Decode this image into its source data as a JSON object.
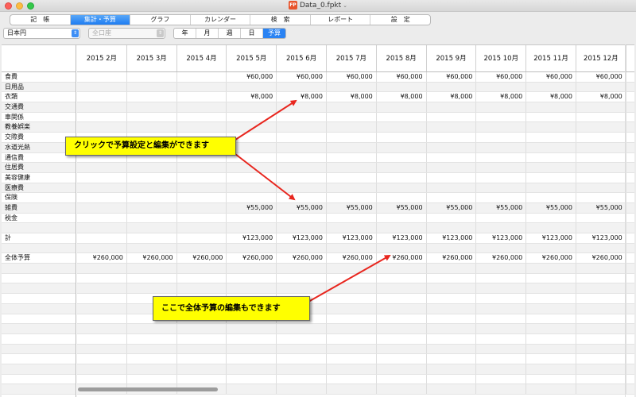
{
  "window": {
    "title": "Data_0.fpkt",
    "doc_icon": "FP"
  },
  "tabs": [
    {
      "label": "記　帳",
      "active": false
    },
    {
      "label": "集計・予算",
      "active": true
    },
    {
      "label": "グラフ",
      "active": false
    },
    {
      "label": "カレンダー",
      "active": false
    },
    {
      "label": "検　索",
      "active": false
    },
    {
      "label": "レポート",
      "active": false
    },
    {
      "label": "設　定",
      "active": false
    }
  ],
  "toolbar": {
    "currency": "日本円",
    "account": "全口座",
    "periods": [
      {
        "label": "年",
        "active": false
      },
      {
        "label": "月",
        "active": false
      },
      {
        "label": "週",
        "active": false
      },
      {
        "label": "日",
        "active": false
      },
      {
        "label": "予算",
        "active": true
      }
    ]
  },
  "table": {
    "columns": [
      "2015 2月",
      "2015 3月",
      "2015 4月",
      "2015 5月",
      "2015 6月",
      "2015 7月",
      "2015 8月",
      "2015 9月",
      "2015 10月",
      "2015 11月",
      "2015 12月"
    ],
    "rows": [
      {
        "label": "食費",
        "values": [
          "",
          "",
          "",
          "¥60,000",
          "¥60,000",
          "¥60,000",
          "¥60,000",
          "¥60,000",
          "¥60,000",
          "¥60,000",
          "¥60,000"
        ]
      },
      {
        "label": "日用品",
        "values": [
          "",
          "",
          "",
          "",
          "",
          "",
          "",
          "",
          "",
          "",
          ""
        ]
      },
      {
        "label": "衣類",
        "values": [
          "",
          "",
          "",
          "¥8,000",
          "¥8,000",
          "¥8,000",
          "¥8,000",
          "¥8,000",
          "¥8,000",
          "¥8,000",
          "¥8,000"
        ]
      },
      {
        "label": "交通費",
        "values": [
          "",
          "",
          "",
          "",
          "",
          "",
          "",
          "",
          "",
          "",
          ""
        ]
      },
      {
        "label": "車関係",
        "values": [
          "",
          "",
          "",
          "",
          "",
          "",
          "",
          "",
          "",
          "",
          ""
        ]
      },
      {
        "label": "教養娯楽",
        "values": [
          "",
          "",
          "",
          "",
          "",
          "",
          "",
          "",
          "",
          "",
          ""
        ]
      },
      {
        "label": "交際費",
        "values": [
          "",
          "",
          "",
          "",
          "",
          "",
          "",
          "",
          "",
          "",
          ""
        ]
      },
      {
        "label": "水道光熱",
        "values": [
          "",
          "",
          "",
          "",
          "",
          "",
          "",
          "",
          "",
          "",
          ""
        ]
      },
      {
        "label": "通信費",
        "values": [
          "",
          "",
          "",
          "",
          "",
          "",
          "",
          "",
          "",
          "",
          ""
        ]
      },
      {
        "label": "住居費",
        "values": [
          "",
          "",
          "",
          "",
          "",
          "",
          "",
          "",
          "",
          "",
          ""
        ]
      },
      {
        "label": "美容健康",
        "values": [
          "",
          "",
          "",
          "",
          "",
          "",
          "",
          "",
          "",
          "",
          ""
        ]
      },
      {
        "label": "医療費",
        "values": [
          "",
          "",
          "",
          "",
          "",
          "",
          "",
          "",
          "",
          "",
          ""
        ]
      },
      {
        "label": "保険",
        "values": [
          "",
          "",
          "",
          "",
          "",
          "",
          "",
          "",
          "",
          "",
          ""
        ]
      },
      {
        "label": "雑費",
        "values": [
          "",
          "",
          "",
          "¥55,000",
          "¥55,000",
          "¥55,000",
          "¥55,000",
          "¥55,000",
          "¥55,000",
          "¥55,000",
          "¥55,000"
        ]
      },
      {
        "label": "税金",
        "values": [
          "",
          "",
          "",
          "",
          "",
          "",
          "",
          "",
          "",
          "",
          ""
        ]
      },
      {
        "label": "",
        "values": [
          "",
          "",
          "",
          "",
          "",
          "",
          "",
          "",
          "",
          "",
          ""
        ]
      },
      {
        "label": "計",
        "values": [
          "",
          "",
          "",
          "¥123,000",
          "¥123,000",
          "¥123,000",
          "¥123,000",
          "¥123,000",
          "¥123,000",
          "¥123,000",
          "¥123,000"
        ]
      },
      {
        "label": "",
        "values": [
          "",
          "",
          "",
          "",
          "",
          "",
          "",
          "",
          "",
          "",
          ""
        ]
      },
      {
        "label": "全体予算",
        "values": [
          "¥260,000",
          "¥260,000",
          "¥260,000",
          "¥260,000",
          "¥260,000",
          "¥260,000",
          "¥260,000",
          "¥260,000",
          "¥260,000",
          "¥260,000",
          "¥260,000"
        ]
      }
    ],
    "empty_rows": 13
  },
  "callouts": {
    "edit_budget": "クリックで予算設定と編集ができます",
    "edit_total": "ここで全体予算の編集もできます"
  },
  "colors": {
    "callout": "#ffff00",
    "arrow": "#e8261e",
    "accent": "#2a83f3"
  }
}
